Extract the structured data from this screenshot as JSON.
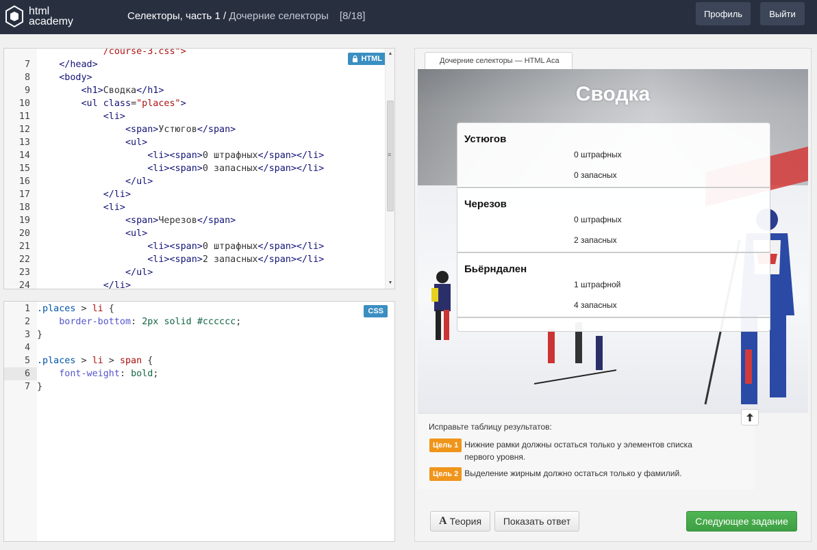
{
  "header": {
    "logo_line1": "html",
    "logo_line2": "academy",
    "course": "Селекторы, часть 1",
    "separator": "/",
    "lesson": "Дочерние селекторы",
    "progress": "[8/18]",
    "profile_label": "Профиль",
    "logout_label": "Выйти"
  },
  "html_editor": {
    "badge": "HTML",
    "lines": [
      {
        "n": "",
        "parts": [
          {
            "t": "            /course-3.css\">",
            "c": "str"
          }
        ]
      },
      {
        "n": "7",
        "parts": [
          {
            "t": "    ",
            "c": "txt"
          },
          {
            "t": "</head>",
            "c": "tg"
          }
        ]
      },
      {
        "n": "8",
        "parts": [
          {
            "t": "    ",
            "c": "txt"
          },
          {
            "t": "<body>",
            "c": "tg"
          }
        ]
      },
      {
        "n": "9",
        "parts": [
          {
            "t": "        ",
            "c": "txt"
          },
          {
            "t": "<h1>",
            "c": "tg"
          },
          {
            "t": "Сводка",
            "c": "txt"
          },
          {
            "t": "</h1>",
            "c": "tg"
          }
        ]
      },
      {
        "n": "10",
        "parts": [
          {
            "t": "        ",
            "c": "txt"
          },
          {
            "t": "<ul ",
            "c": "tg"
          },
          {
            "t": "class",
            "c": "tg"
          },
          {
            "t": "=",
            "c": "txt"
          },
          {
            "t": "\"places\"",
            "c": "str"
          },
          {
            "t": ">",
            "c": "tg"
          }
        ]
      },
      {
        "n": "11",
        "parts": [
          {
            "t": "            ",
            "c": "txt"
          },
          {
            "t": "<li>",
            "c": "tg"
          }
        ]
      },
      {
        "n": "12",
        "parts": [
          {
            "t": "                ",
            "c": "txt"
          },
          {
            "t": "<span>",
            "c": "tg"
          },
          {
            "t": "Устюгов",
            "c": "txt"
          },
          {
            "t": "</span>",
            "c": "tg"
          }
        ]
      },
      {
        "n": "13",
        "parts": [
          {
            "t": "                ",
            "c": "txt"
          },
          {
            "t": "<ul>",
            "c": "tg"
          }
        ]
      },
      {
        "n": "14",
        "parts": [
          {
            "t": "                    ",
            "c": "txt"
          },
          {
            "t": "<li><span>",
            "c": "tg"
          },
          {
            "t": "0 штрафных",
            "c": "txt"
          },
          {
            "t": "</span></li>",
            "c": "tg"
          }
        ]
      },
      {
        "n": "15",
        "parts": [
          {
            "t": "                    ",
            "c": "txt"
          },
          {
            "t": "<li><span>",
            "c": "tg"
          },
          {
            "t": "0 запасных",
            "c": "txt"
          },
          {
            "t": "</span></li>",
            "c": "tg"
          }
        ]
      },
      {
        "n": "16",
        "parts": [
          {
            "t": "                ",
            "c": "txt"
          },
          {
            "t": "</ul>",
            "c": "tg"
          }
        ]
      },
      {
        "n": "17",
        "parts": [
          {
            "t": "            ",
            "c": "txt"
          },
          {
            "t": "</li>",
            "c": "tg"
          }
        ]
      },
      {
        "n": "18",
        "parts": [
          {
            "t": "            ",
            "c": "txt"
          },
          {
            "t": "<li>",
            "c": "tg"
          }
        ]
      },
      {
        "n": "19",
        "parts": [
          {
            "t": "                ",
            "c": "txt"
          },
          {
            "t": "<span>",
            "c": "tg"
          },
          {
            "t": "Черезов",
            "c": "txt"
          },
          {
            "t": "</span>",
            "c": "tg"
          }
        ]
      },
      {
        "n": "20",
        "parts": [
          {
            "t": "                ",
            "c": "txt"
          },
          {
            "t": "<ul>",
            "c": "tg"
          }
        ]
      },
      {
        "n": "21",
        "parts": [
          {
            "t": "                    ",
            "c": "txt"
          },
          {
            "t": "<li><span>",
            "c": "tg"
          },
          {
            "t": "0 штрафных",
            "c": "txt"
          },
          {
            "t": "</span></li>",
            "c": "tg"
          }
        ]
      },
      {
        "n": "22",
        "parts": [
          {
            "t": "                    ",
            "c": "txt"
          },
          {
            "t": "<li><span>",
            "c": "tg"
          },
          {
            "t": "2 запасных",
            "c": "txt"
          },
          {
            "t": "</span></li>",
            "c": "tg"
          }
        ]
      },
      {
        "n": "23",
        "parts": [
          {
            "t": "                ",
            "c": "txt"
          },
          {
            "t": "</ul>",
            "c": "tg"
          }
        ]
      },
      {
        "n": "24",
        "parts": [
          {
            "t": "            ",
            "c": "txt"
          },
          {
            "t": "</li>",
            "c": "tg"
          }
        ]
      }
    ]
  },
  "css_editor": {
    "badge": "CSS",
    "active_line": 6,
    "lines": [
      {
        "n": "1",
        "parts": [
          {
            "t": ".places",
            "c": "sel-cls"
          },
          {
            "t": " > ",
            "c": "punct"
          },
          {
            "t": "li",
            "c": "sel-el"
          },
          {
            "t": " {",
            "c": "punct"
          }
        ]
      },
      {
        "n": "2",
        "parts": [
          {
            "t": "    ",
            "c": "txt"
          },
          {
            "t": "border-bottom",
            "c": "prop"
          },
          {
            "t": ": ",
            "c": "punct"
          },
          {
            "t": "2px",
            "c": "num"
          },
          {
            "t": " ",
            "c": "txt"
          },
          {
            "t": "solid",
            "c": "val"
          },
          {
            "t": " ",
            "c": "txt"
          },
          {
            "t": "#cccccc",
            "c": "hexv"
          },
          {
            "t": ";",
            "c": "punct"
          }
        ]
      },
      {
        "n": "3",
        "parts": [
          {
            "t": "}",
            "c": "punct"
          }
        ]
      },
      {
        "n": "4",
        "parts": []
      },
      {
        "n": "5",
        "parts": [
          {
            "t": ".places",
            "c": "sel-cls"
          },
          {
            "t": " > ",
            "c": "punct"
          },
          {
            "t": "li",
            "c": "sel-el"
          },
          {
            "t": " > ",
            "c": "punct"
          },
          {
            "t": "span",
            "c": "sel-el"
          },
          {
            "t": " {",
            "c": "punct"
          }
        ]
      },
      {
        "n": "6",
        "parts": [
          {
            "t": "    ",
            "c": "txt"
          },
          {
            "t": "font-weight",
            "c": "prop"
          },
          {
            "t": ": ",
            "c": "punct"
          },
          {
            "t": "bold",
            "c": "val"
          },
          {
            "t": ";",
            "c": "punct"
          }
        ]
      },
      {
        "n": "7",
        "parts": [
          {
            "t": "}",
            "c": "punct"
          }
        ]
      }
    ]
  },
  "preview": {
    "tab_title": "Дочерние селекторы — HTML Aca",
    "heading": "Сводка",
    "results": [
      {
        "name": "Устюгов",
        "fines": "0 штрафных",
        "reserves": "0 запасных"
      },
      {
        "name": "Черезов",
        "fines": "0 штрафных",
        "reserves": "2 запасных"
      },
      {
        "name": "Бьёрндален",
        "fines": "1 штрафной",
        "reserves": "4 запасных"
      }
    ]
  },
  "task": {
    "intro": "Исправьте таблицу результатов:",
    "goal1_tag": "Цель 1",
    "goal1_text": "Нижние рамки должны остаться только у элементов списка первого уровня.",
    "goal2_tag": "Цель 2",
    "goal2_text": "Выделение жирным должно остаться только у фамилий."
  },
  "buttons": {
    "theory_icon": "A",
    "theory": "Теория",
    "answer": "Показать ответ",
    "next": "Следующее задание"
  },
  "colors": {
    "topbar": "#283040",
    "accent_blue": "#3a8ec1",
    "goal_orange": "#f0951b",
    "next_green": "#4fb554"
  }
}
